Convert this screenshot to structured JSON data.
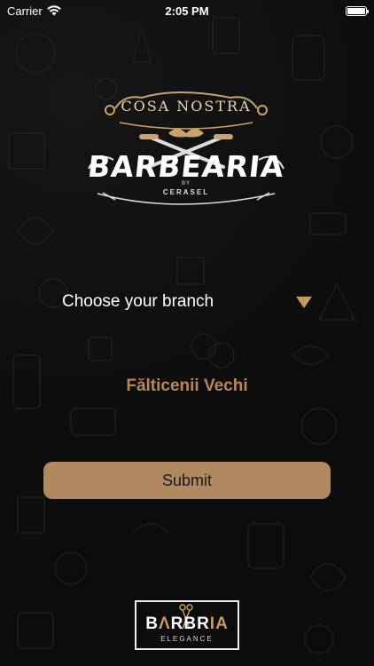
{
  "status_bar": {
    "carrier": "Carrier",
    "time": "2:05 PM"
  },
  "logo": {
    "top_text": "COSA NOSTRA",
    "main_text": "BARBEARIA",
    "by_text": "BY",
    "sub_text": "CERASEL"
  },
  "branch_picker": {
    "label": "Choose your branch",
    "selected_value": "Fălticenii Vechi"
  },
  "submit": {
    "label": "Submit"
  },
  "footer_logo": {
    "main_prefix": "B",
    "main_accent": "Λ",
    "main_middle": "RBR",
    "main_suffix": "IA",
    "sub_text": "ELEGANCE"
  },
  "colors": {
    "accent": "#b1895e",
    "arrow": "#c79a5f",
    "background": "#0b0b0b",
    "selected_text": "#b7875a"
  }
}
